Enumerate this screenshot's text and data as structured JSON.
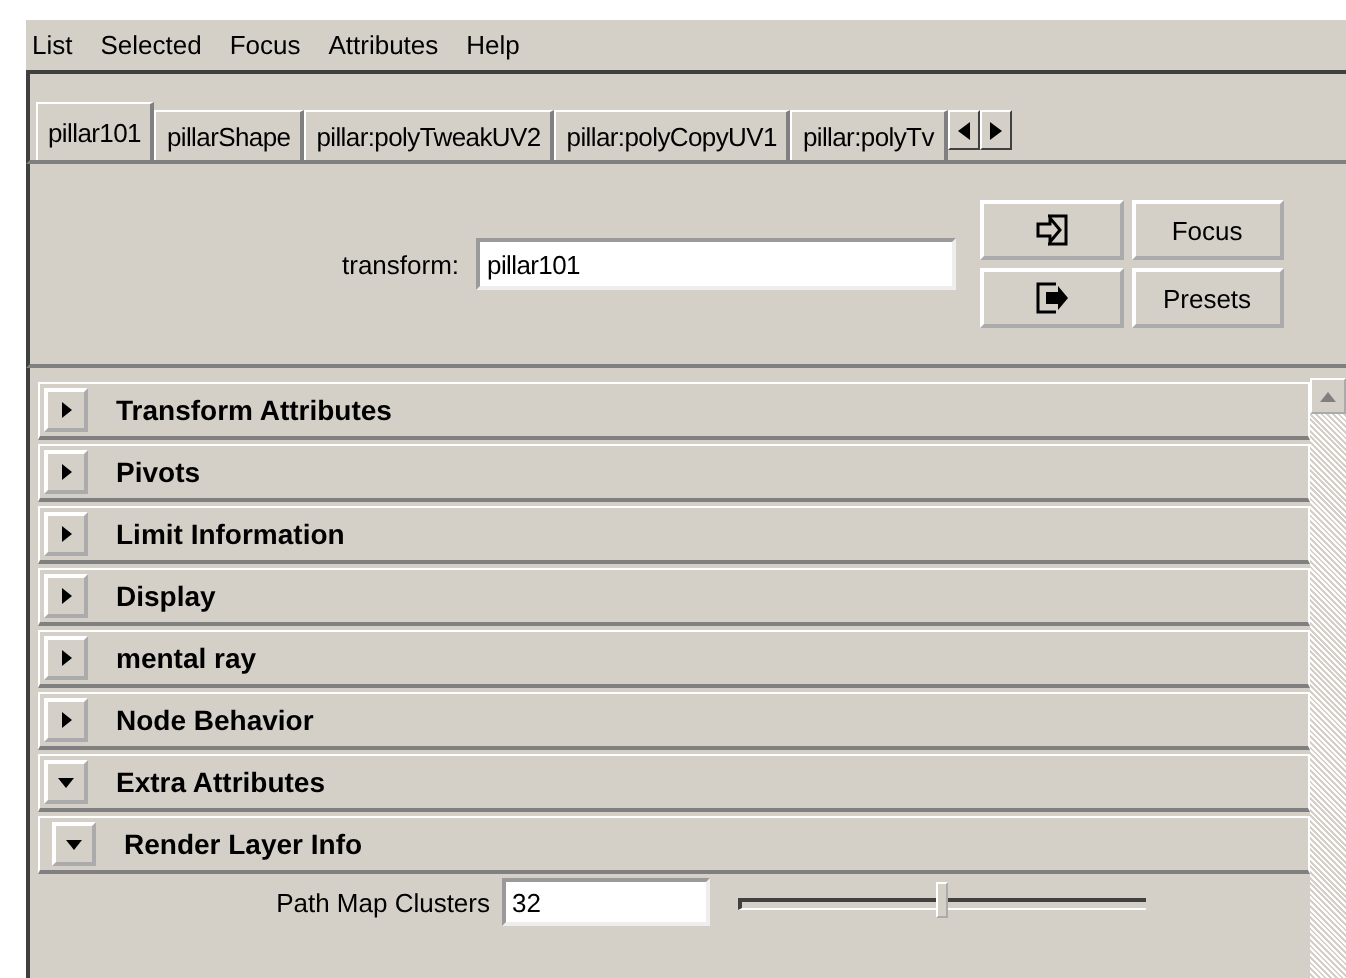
{
  "menu": [
    "List",
    "Selected",
    "Focus",
    "Attributes",
    "Help"
  ],
  "tabs": [
    {
      "label": "pillar101",
      "selected": true
    },
    {
      "label": "pillarShape",
      "selected": false
    },
    {
      "label": "pillar:polyTweakUV2",
      "selected": false
    },
    {
      "label": "pillar:polyCopyUV1",
      "selected": false
    },
    {
      "label": "pillar:polyTv",
      "selected": false
    }
  ],
  "node": {
    "label": "transform:",
    "value": "pillar101"
  },
  "buttons": [
    "Focus",
    "Presets"
  ],
  "sections": [
    {
      "title": "Transform Attributes",
      "expanded": false
    },
    {
      "title": "Pivots",
      "expanded": false
    },
    {
      "title": "Limit Information",
      "expanded": false
    },
    {
      "title": "Display",
      "expanded": false
    },
    {
      "title": "mental ray",
      "expanded": false
    },
    {
      "title": "Node Behavior",
      "expanded": false
    },
    {
      "title": "Extra Attributes",
      "expanded": true,
      "children": [
        {
          "title": "Render Layer Info",
          "expanded": true,
          "fields": [
            {
              "label": "Path Map Clusters",
              "value": "32",
              "level": 0.5
            }
          ]
        }
      ]
    }
  ]
}
